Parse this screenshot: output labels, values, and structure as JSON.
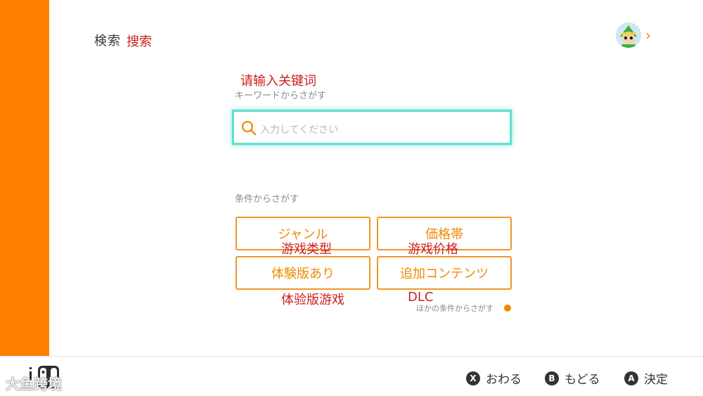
{
  "header": {
    "title": "検索",
    "title_annotation": "搜索"
  },
  "keyword": {
    "annotation": "请输入关键词",
    "label": "キーワードからさがす",
    "placeholder": "入力してください"
  },
  "conditions": {
    "label": "条件からさがす",
    "buttons": [
      {
        "label": "ジャンル",
        "annotation": "游戏类型"
      },
      {
        "label": "価格帯",
        "annotation": "游戏价格"
      },
      {
        "label": "体験版あり",
        "annotation": "体验版游戏"
      },
      {
        "label": "追加コンテンツ",
        "annotation": "DLC"
      }
    ],
    "other_label": "ほかの条件からさがす"
  },
  "footer": {
    "hints": [
      {
        "button": "X",
        "label": "おわる"
      },
      {
        "button": "B",
        "label": "もどる"
      },
      {
        "button": "A",
        "label": "決定"
      }
    ],
    "watermark": "大鱼跨境"
  },
  "icons": {
    "search": "search-icon",
    "chevron": "chevron-right-icon",
    "switch_logo": "switch-logo-icon"
  },
  "colors": {
    "sidebar": "#ff7f00",
    "accent": "#f08a00",
    "focus": "#5fe0d2",
    "annotation": "#cc1f1f"
  }
}
